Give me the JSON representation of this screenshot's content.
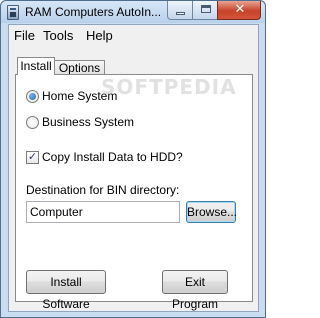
{
  "window": {
    "title": "RAM Computers AutoIn...",
    "close_glyph": "✕"
  },
  "menu": {
    "file": "File",
    "tools": "Tools",
    "help": "Help"
  },
  "tabs": {
    "install": "Install",
    "options": "Options"
  },
  "install": {
    "radio_home": "Home System",
    "radio_business": "Business System",
    "selected_system": "Home System",
    "copy_checkbox_label": "Copy Install Data to HDD?",
    "copy_checked": true,
    "check_glyph": "✓",
    "destination_label": "Destination for BIN directory:",
    "destination_value": "Computer",
    "browse_button": "Browse...",
    "install_button": "Install Software",
    "exit_button": "Exit Program"
  },
  "watermark": "SOFTPEDIA"
}
